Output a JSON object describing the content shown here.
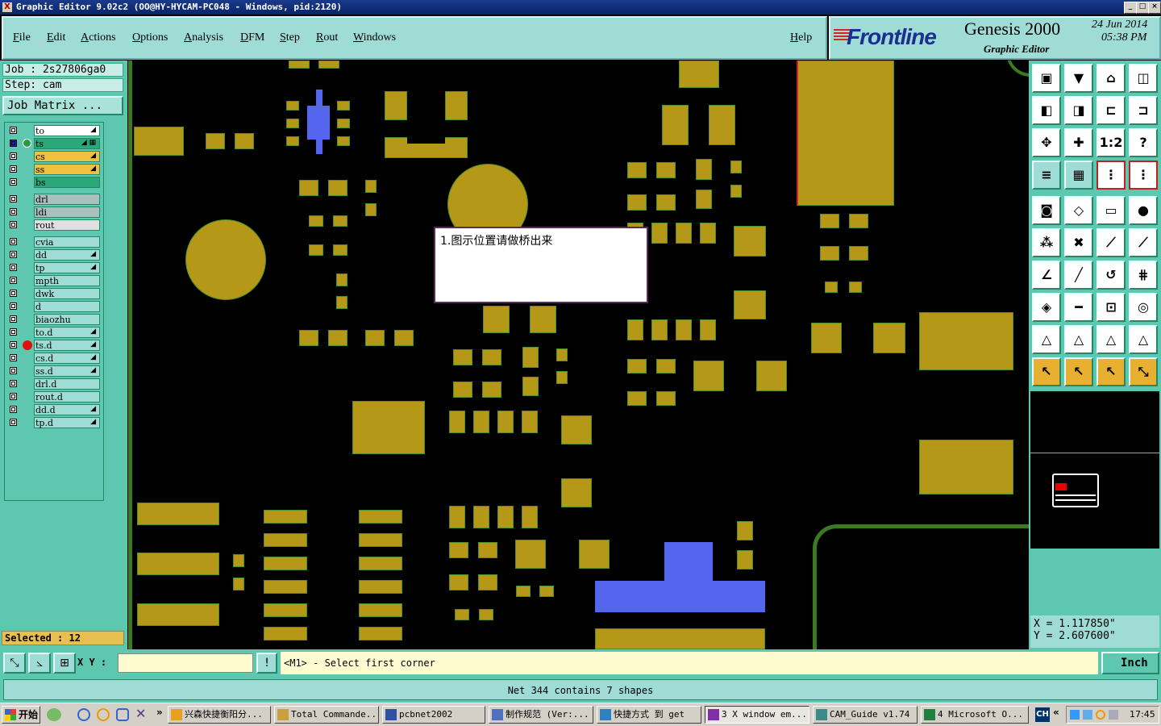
{
  "window": {
    "title": "Graphic Editor 9.02c2 (OO@HY-HYCAM-PC048 - Windows, pid:2120)",
    "x_icon_label": "X",
    "buttons": [
      "_",
      "□",
      "×"
    ]
  },
  "menu": {
    "items": [
      "File",
      "Edit",
      "Actions",
      "Options",
      "Analysis",
      "DFM",
      "Step",
      "Rout",
      "Windows"
    ],
    "help": "Help"
  },
  "brand": {
    "logo": "Frontline",
    "product": "Genesis 2000",
    "subtitle": "Graphic Editor",
    "date": "24 Jun 2014",
    "time": "05:38 PM"
  },
  "job": {
    "job_line": "Job : 2s27806ga0",
    "step_line": "Step: cam",
    "matrix_button": "Job Matrix ..."
  },
  "layers": [
    {
      "name": "to",
      "color": "#ffffff",
      "mark": "◢"
    },
    {
      "name": "ts",
      "color": "#2aa87a",
      "mark": "◢ ▦",
      "work": true,
      "selected": true
    },
    {
      "name": "cs",
      "color": "#f0c040",
      "mark": "◢"
    },
    {
      "name": "ss",
      "color": "#f0c040",
      "mark": "◢"
    },
    {
      "name": "bs",
      "color": "#2aa87a",
      "mark": ""
    },
    {
      "name": "drl",
      "color": "#a8c0c0",
      "mark": "",
      "gap": true
    },
    {
      "name": "ldi",
      "color": "#a8c0c0",
      "mark": ""
    },
    {
      "name": "rout",
      "color": "#e0e0e0",
      "mark": ""
    },
    {
      "name": "cvia",
      "color": "#9fdcd6",
      "mark": "",
      "gap": true
    },
    {
      "name": "dd",
      "color": "#9fdcd6",
      "mark": "◢"
    },
    {
      "name": "tp",
      "color": "#9fdcd6",
      "mark": "◢"
    },
    {
      "name": "mpth",
      "color": "#9fdcd6",
      "mark": ""
    },
    {
      "name": "dwk",
      "color": "#9fdcd6",
      "mark": ""
    },
    {
      "name": "d",
      "color": "#9fdcd6",
      "mark": ""
    },
    {
      "name": "biaozhu",
      "color": "#9fdcd6",
      "mark": ""
    },
    {
      "name": "to.d",
      "color": "#9fdcd6",
      "mark": "◢"
    },
    {
      "name": "ts.d",
      "color": "#9fdcd6",
      "mark": "◢",
      "dot": true
    },
    {
      "name": "cs.d",
      "color": "#9fdcd6",
      "mark": "◢"
    },
    {
      "name": "ss.d",
      "color": "#9fdcd6",
      "mark": "◢"
    },
    {
      "name": "drl.d",
      "color": "#9fdcd6",
      "mark": ""
    },
    {
      "name": "rout.d",
      "color": "#9fdcd6",
      "mark": ""
    },
    {
      "name": "dd.d",
      "color": "#9fdcd6",
      "mark": "◢"
    },
    {
      "name": "tp.d",
      "color": "#9fdcd6",
      "mark": "◢"
    }
  ],
  "selected_count": "Selected : 12",
  "note": "1.图示位置请做桥出来",
  "coords": {
    "x": "X = 1.117850\"",
    "y": "Y = 2.607600\""
  },
  "command": {
    "xy_label": "X Y :",
    "xy_value": "",
    "alert_btn": "!",
    "prompt": "<M1> - Select first corner",
    "unit": "Inch"
  },
  "status": "Net 344 contains 7 shapes",
  "taskbar": {
    "start": "开始",
    "tasks": [
      {
        "label": "兴森快捷衡阳分...",
        "icon": "star-icon"
      },
      {
        "label": "Total Commande...",
        "icon": "folder-icon"
      },
      {
        "label": "pcbnet2002",
        "icon": "app-icon"
      },
      {
        "label": "制作规范 (Ver:...",
        "icon": "doc-icon"
      },
      {
        "label": "快捷方式 到 get",
        "icon": "shortcut-icon"
      },
      {
        "label": "3 X window em...",
        "icon": "x-icon",
        "active": true
      },
      {
        "label": "CAM_Guide v1.74",
        "icon": "car-icon"
      },
      {
        "label": "4 Microsoft O...",
        "icon": "excel-icon"
      }
    ],
    "lang": "CH",
    "clock": "17:45"
  }
}
